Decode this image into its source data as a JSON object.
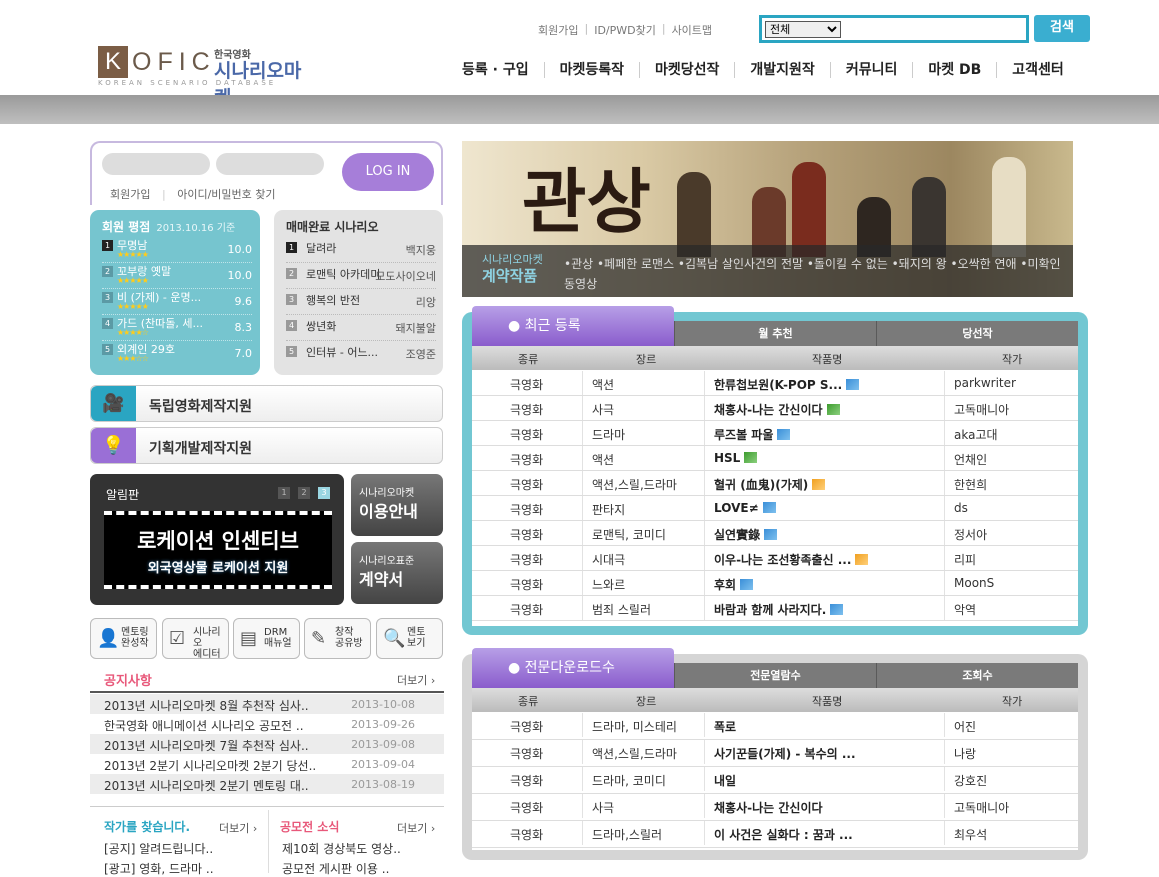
{
  "header": {
    "top_links": [
      "회원가입",
      "ID/PWD찾기",
      "사이트맵"
    ],
    "search": {
      "select_value": "전체",
      "button_label": "검색"
    },
    "logo": {
      "letters": [
        "K",
        "OFIC"
      ],
      "sub_small": "한국영화",
      "sub_big": "시나리오마켓",
      "tagline": "KOREAN SCENARIO DATABASE"
    },
    "nav": [
      "등록 · 구입",
      "마켓등록작",
      "마켓당선작",
      "개발지원작",
      "커뮤니티",
      "마켓 DB",
      "고객센터"
    ]
  },
  "login": {
    "button_label": "LOG IN",
    "links": [
      "회원가입",
      "아이디/비밀번호 찾기"
    ]
  },
  "ratings": {
    "title": "회원 평점",
    "date": "2013.10.16 기준",
    "items": [
      {
        "num": "1",
        "title": "무명남",
        "stars": "★★★★★",
        "score": "10.0"
      },
      {
        "num": "2",
        "title": "꼬부랑 옛말",
        "stars": "★★★★★",
        "score": "10.0"
      },
      {
        "num": "3",
        "title": "비 (가제) - 운명...",
        "stars": "★★★★★",
        "score": "9.6"
      },
      {
        "num": "4",
        "title": "가드 (찬따돌, 세...",
        "stars": "★★★★☆",
        "score": "8.3"
      },
      {
        "num": "5",
        "title": "외계인 29호",
        "stars": "★★★☆☆",
        "score": "7.0"
      }
    ]
  },
  "sold": {
    "title": "매매완료 시나리오",
    "items": [
      {
        "num": "1",
        "title": "달려라",
        "author": "백지웅"
      },
      {
        "num": "2",
        "title": "로맨틱 아카데미",
        "author": "모도사이오네"
      },
      {
        "num": "3",
        "title": "행복의 반전",
        "author": "리앙"
      },
      {
        "num": "4",
        "title": "쌍년화",
        "author": "돼지불알"
      },
      {
        "num": "5",
        "title": "인터뷰 - 어느...",
        "author": "조영준"
      }
    ]
  },
  "support": {
    "indie": "독립영화제작지원",
    "planning": "기획개발제작지원"
  },
  "board": {
    "title": "알림판",
    "pages": [
      "1",
      "2",
      "3"
    ],
    "headline": "로케이션 인센티브",
    "subline": "외국영상물 로케이션 지원"
  },
  "guides": [
    {
      "small": "시나리오마켓",
      "big": "이용안내"
    },
    {
      "small": "시나리오표준",
      "big": "계약서"
    }
  ],
  "quick": [
    {
      "icon": "👤",
      "label1": "멘토링",
      "label2": "완성작"
    },
    {
      "icon": "☑",
      "label1": "시나리오",
      "label2": "에디터"
    },
    {
      "icon": "▤",
      "label1": "DRM",
      "label2": "매뉴얼"
    },
    {
      "icon": "✎",
      "label1": "창작",
      "label2": "공유방"
    },
    {
      "icon": "🔍",
      "label1": "멘토",
      "label2": "보기"
    }
  ],
  "notices": {
    "title": "공지사항",
    "more": "더보기 ›",
    "items": [
      {
        "title": "2013년 시나리오마켓 8월 추천작 심사..",
        "date": "2013-10-08"
      },
      {
        "title": "한국영화 애니메이션 시나리오 공모전 ..",
        "date": "2013-09-26"
      },
      {
        "title": "2013년 시나리오마켓 7월 추천작 심사..",
        "date": "2013-09-08"
      },
      {
        "title": "2013년 2분기 시나리오마켓 2분기 당선..",
        "date": "2013-09-04"
      },
      {
        "title": "2013년 시나리오마켓 2분기 멘토링 대..",
        "date": "2013-08-19"
      }
    ]
  },
  "find_writer": {
    "title": "작가를 찾습니다.",
    "more": "더보기 ›",
    "items": [
      "[공지] 알려드립니다..",
      "[광고] 영화, 드라마 .."
    ]
  },
  "contest": {
    "title": "공모전 소식",
    "more": "더보기 ›",
    "items": [
      "제10회 경상북도 영상..",
      "공모전 게시판 이용 .."
    ]
  },
  "banner": {
    "calligraphy": "관상",
    "small": "시나리오마켓",
    "big": "계약작품",
    "desc": "•관상 •페페한 로맨스 •김복남 살인사건의 전말 •돌이킬 수 없는 •돼지의 왕 •오싹한 연애 •미확인 동영상"
  },
  "recent": {
    "tabs": [
      "최근 등록",
      "월 추천",
      "당선작"
    ],
    "columns": [
      "종류",
      "장르",
      "작품명",
      "작가"
    ],
    "rows": [
      {
        "type": "극영화",
        "genre": "액션",
        "title": "한류첩보원(K-POP S...",
        "flag": "blue",
        "author": "parkwriter"
      },
      {
        "type": "극영화",
        "genre": "사극",
        "title": "채홍사-나는 간신이다",
        "flag": "green",
        "author": "고독매니아"
      },
      {
        "type": "극영화",
        "genre": "드라마",
        "title": "루즈볼 파울",
        "flag": "blue",
        "author": "aka고대"
      },
      {
        "type": "극영화",
        "genre": "액션",
        "title": "HSL",
        "flag": "green",
        "author": "언채인"
      },
      {
        "type": "극영화",
        "genre": "액션,스릴,드라마",
        "title": "혈귀 (血鬼)(가제)",
        "flag": "orange",
        "author": "한현희"
      },
      {
        "type": "극영화",
        "genre": "판타지",
        "title": "LOVE≠",
        "flag": "blue",
        "author": "ds"
      },
      {
        "type": "극영화",
        "genre": "로맨틱, 코미디",
        "title": "실연實錄",
        "flag": "blue",
        "author": "정서아"
      },
      {
        "type": "극영화",
        "genre": "시대극",
        "title": "이우-나는 조선황족출신 ...",
        "flag": "orange",
        "author": "리피"
      },
      {
        "type": "극영화",
        "genre": "느와르",
        "title": "후회",
        "flag": "blue",
        "author": "MoonS"
      },
      {
        "type": "극영화",
        "genre": "범죄 스릴러",
        "title": "바람과 함께 사라지다.",
        "flag": "blue",
        "author": "악역"
      }
    ]
  },
  "download": {
    "tabs": [
      "전문다운로드수",
      "전문열람수",
      "조회수"
    ],
    "columns": [
      "종류",
      "장르",
      "작품명",
      "작가"
    ],
    "rows": [
      {
        "type": "극영화",
        "genre": "드라마, 미스테리",
        "title": "폭로",
        "author": "어진"
      },
      {
        "type": "극영화",
        "genre": "액션,스릴,드라마",
        "title": "사기꾼들(가제) - 복수의 ...",
        "author": "나랑"
      },
      {
        "type": "극영화",
        "genre": "드라마, 코미디",
        "title": "내일",
        "author": "강호진"
      },
      {
        "type": "극영화",
        "genre": "사극",
        "title": "채홍사-나는 간신이다",
        "author": "고독매니아"
      },
      {
        "type": "극영화",
        "genre": "드라마,스릴러",
        "title": "이 사건은 실화다 : 꿈과 ...",
        "author": "최우석"
      }
    ]
  }
}
